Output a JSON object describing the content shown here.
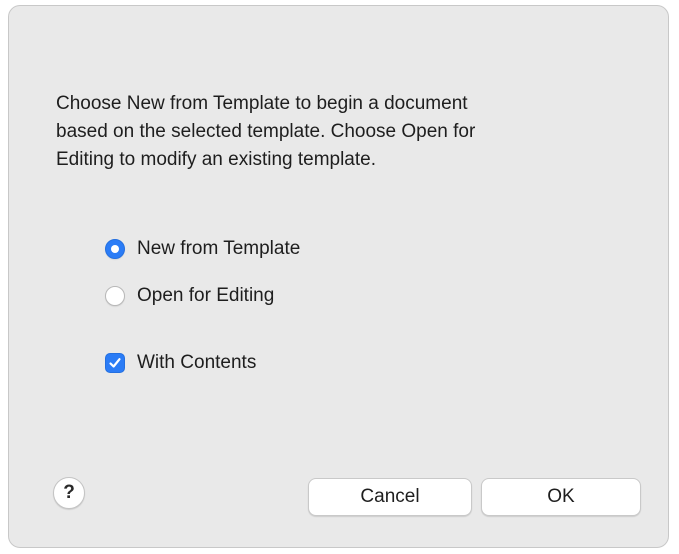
{
  "dialog": {
    "message": "Choose New from Template to begin a document\nbased on the selected template.  Choose Open for\nEditing to modify an existing template.",
    "options": {
      "new_from_template": {
        "label": "New from Template",
        "selected": true
      },
      "open_for_editing": {
        "label": "Open for Editing",
        "selected": false
      }
    },
    "with_contents": {
      "label": "With Contents",
      "checked": true
    },
    "help_label": "?",
    "cancel_label": "Cancel",
    "ok_label": "OK"
  },
  "colors": {
    "accent": "#2b7cf6",
    "dialog_background": "#e9e9e9"
  },
  "icons": {
    "help": "question-mark-icon",
    "checkbox": "checkmark-icon"
  }
}
